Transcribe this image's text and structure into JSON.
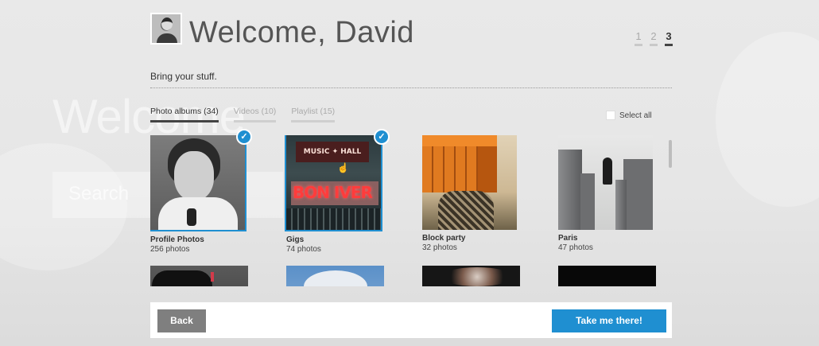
{
  "background": {
    "ghost_title": "Welcome",
    "ghost_search": "Search"
  },
  "header": {
    "title": "Welcome, David",
    "steps": [
      "1",
      "2",
      "3"
    ],
    "active_step": "3"
  },
  "subtitle": "Bring your stuff.",
  "tabs": [
    {
      "label": "Photo albums (34)",
      "active": true
    },
    {
      "label": "Videos (10)",
      "active": false
    },
    {
      "label": "Playlist (15)",
      "active": false
    }
  ],
  "select_all_label": "Select all",
  "albums": [
    {
      "name": "Profile Photos",
      "count": "256 photos",
      "selected": true
    },
    {
      "name": "Gigs",
      "count": "74 photos",
      "selected": true,
      "thumb_text": "MUSIC ✦ HALL",
      "marquee_text": "BON IVER"
    },
    {
      "name": "Block party",
      "count": "32 photos",
      "selected": false
    },
    {
      "name": "Paris",
      "count": "47 photos",
      "selected": false
    }
  ],
  "icons": {
    "check": "check-icon",
    "cursor": "hand-cursor-icon"
  },
  "footer": {
    "back_label": "Back",
    "go_label": "Take me there!"
  },
  "colors": {
    "accent": "#1f8fd1",
    "back_button": "#7f7f7f"
  }
}
